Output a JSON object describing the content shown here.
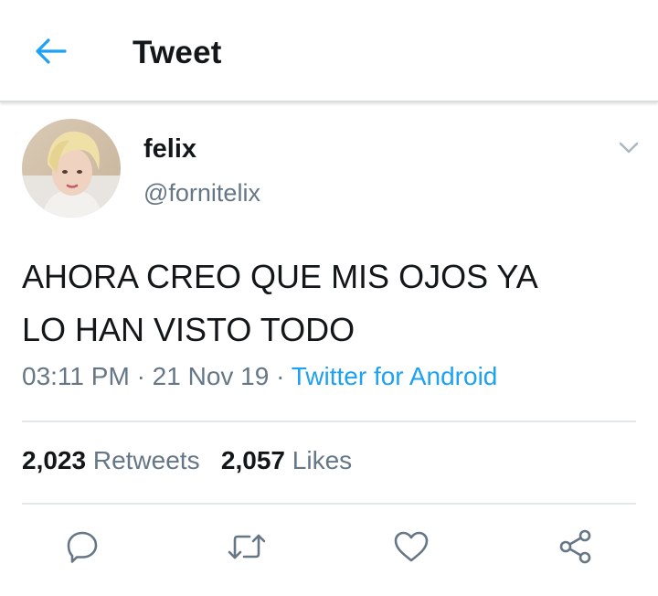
{
  "header": {
    "title": "Tweet",
    "back_icon": "arrow-left-icon",
    "accent": "#1da1f2"
  },
  "tweet": {
    "author": {
      "name": "felix",
      "handle": "@fornitelix"
    },
    "text": "AHORA CREO QUE MIS OJOS YA\nLO HAN VISTO TODO",
    "time": "03:11 PM",
    "separator": "·",
    "date": "21 Nov 19",
    "source": "Twitter for Android",
    "retweets_count": "2,023",
    "retweets_label": "Retweets",
    "likes_count": "2,057",
    "likes_label": "Likes"
  },
  "actions": [
    {
      "name": "reply",
      "icon": "reply-icon"
    },
    {
      "name": "retweet",
      "icon": "retweet-icon"
    },
    {
      "name": "like",
      "icon": "heart-icon"
    },
    {
      "name": "share",
      "icon": "share-icon"
    }
  ],
  "colors": {
    "primary_text": "#14171a",
    "secondary_text": "#657786",
    "link": "#1da1f2",
    "divider": "#e1e8ed"
  }
}
